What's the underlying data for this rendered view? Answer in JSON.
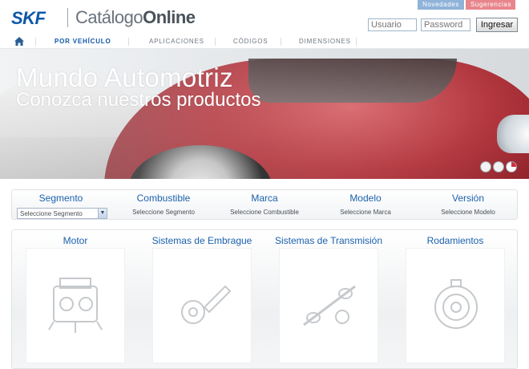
{
  "header": {
    "logo": "SKF",
    "brand_light": "Catálogo",
    "brand_bold": "Online",
    "links": [
      "Novedades",
      "Sugerencias"
    ],
    "login": {
      "user_placeholder": "Usuario",
      "pass_placeholder": "Password",
      "submit_label": "Ingresar"
    }
  },
  "nav": {
    "home_icon": "home-icon",
    "items": [
      "POR VEHÍCULO",
      "APLICACIONES",
      "CÓDIGOS",
      "DIMENSIONES"
    ],
    "active_index": 0
  },
  "hero": {
    "title": "Mundo Automotriz",
    "subtitle": "Conozca nuestros productos",
    "slides": 3,
    "active_slide": 3
  },
  "filters": [
    {
      "label": "Segmento",
      "value": "Seleccione Segmento"
    },
    {
      "label": "Combustible",
      "value": "Seleccione Segmento"
    },
    {
      "label": "Marca",
      "value": "Seleccione Combustible"
    },
    {
      "label": "Modelo",
      "value": "Seleccione Marca"
    },
    {
      "label": "Versión",
      "value": "Seleccione Modelo"
    }
  ],
  "categories": [
    {
      "title": "Motor",
      "icon": "engine-icon"
    },
    {
      "title": "Sistemas de Embrague",
      "icon": "clutch-icon"
    },
    {
      "title": "Sistemas de Transmisión",
      "icon": "driveshaft-icon"
    },
    {
      "title": "Rodamientos",
      "icon": "bearing-icon"
    }
  ],
  "colors": {
    "brand_blue": "#0f58a8",
    "link_blue": "#1b61ad",
    "news_pill": "#8fb3d9",
    "suggest_pill": "#e8858b",
    "slide_active": "#d3303c"
  }
}
